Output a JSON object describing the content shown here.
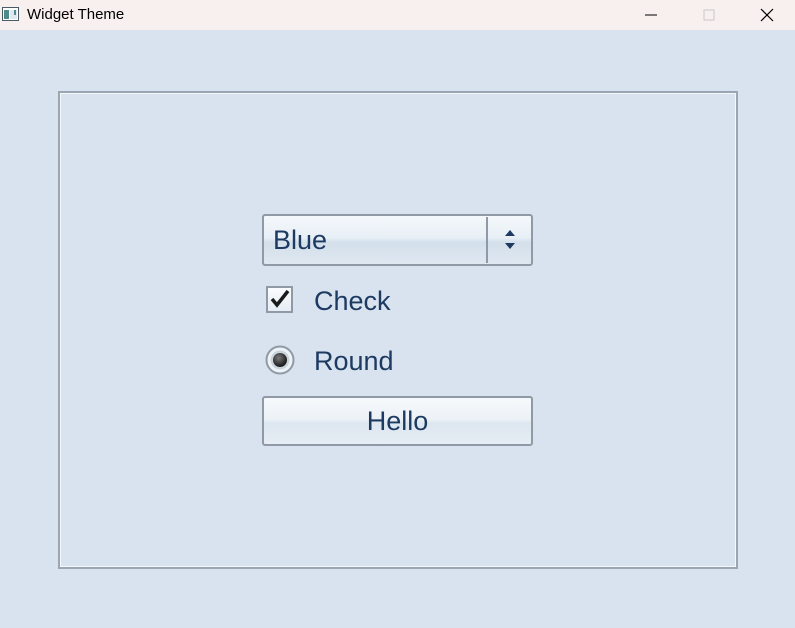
{
  "window": {
    "title": "Widget Theme"
  },
  "titlebar": {
    "icons": [
      "app-icon",
      "minimize-icon",
      "maximize-icon",
      "close-icon"
    ]
  },
  "form": {
    "combo": {
      "selected": "Blue"
    },
    "checkbox": {
      "label": "Check",
      "checked": true
    },
    "radio": {
      "label": "Round",
      "selected": true
    },
    "button": {
      "label": "Hello"
    }
  },
  "colors": {
    "background": "#d8e3ef",
    "titlebar": "#f8f0ee",
    "text": "#1d3a61",
    "border": "#8f9aa6"
  }
}
